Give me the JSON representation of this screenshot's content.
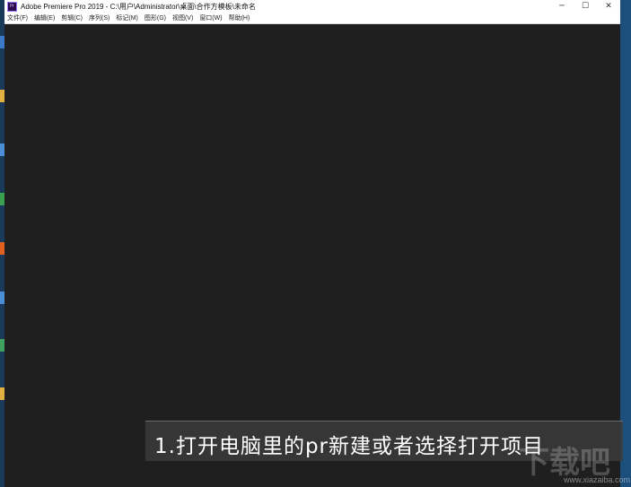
{
  "window": {
    "app_icon_text": "Pr",
    "title": "Adobe Premiere Pro 2019 - C:\\用户\\Administrator\\桌面\\合作方模板\\未命名",
    "controls": {
      "minimize": "─",
      "maximize": "☐",
      "close": "✕"
    }
  },
  "menubar": {
    "items": [
      {
        "label": "文件(F)"
      },
      {
        "label": "编辑(E)"
      },
      {
        "label": "剪辑(C)"
      },
      {
        "label": "序列(S)"
      },
      {
        "label": "标记(M)"
      },
      {
        "label": "图形(G)"
      },
      {
        "label": "视图(V)"
      },
      {
        "label": "窗口(W)"
      },
      {
        "label": "帮助(H)"
      }
    ]
  },
  "caption": {
    "text": "1.打开电脑里的pr新建或者选择打开项目"
  },
  "watermark": {
    "logo": "下载吧",
    "url": "www.xiazaiba.com"
  },
  "colors": {
    "workspace": "#1f1f1f",
    "titlebar": "#ffffff",
    "accent_pr": "#9a7bff",
    "desktop": "#1d4f7c"
  }
}
